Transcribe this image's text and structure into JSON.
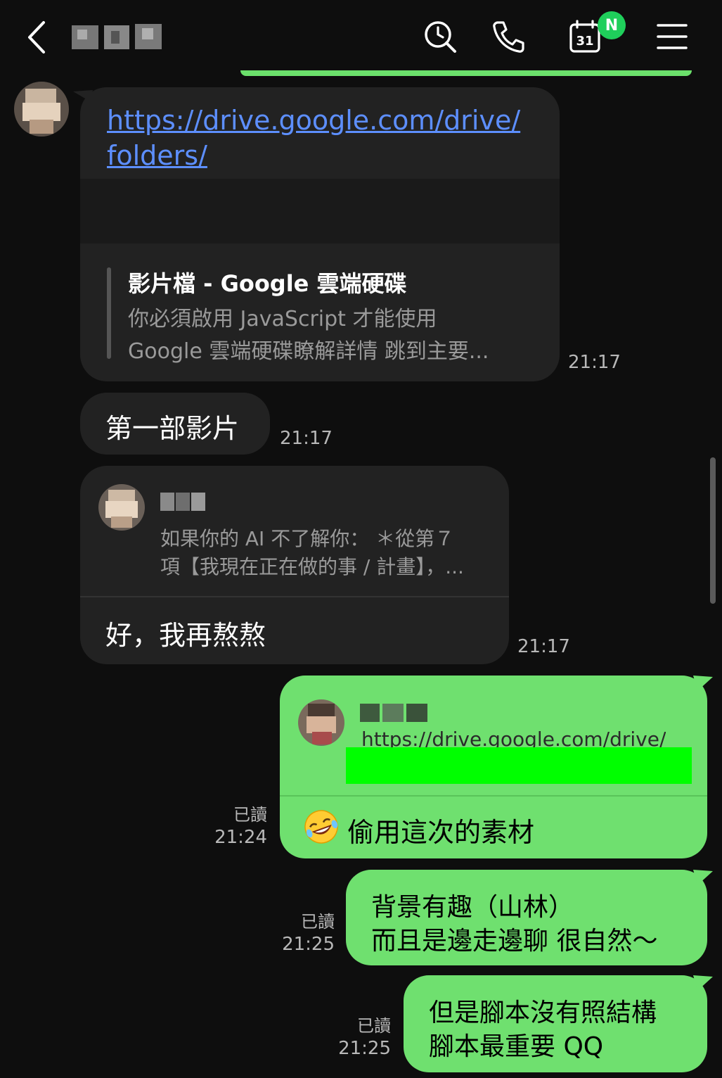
{
  "header": {
    "calendar_day": "31",
    "calendar_badge": "N"
  },
  "messages": {
    "link_card": {
      "url_line1": "https://drive.google.com/drive/",
      "url_line2": "folders/",
      "preview_title": "影片檔 - Google 雲端硬碟",
      "preview_desc1": "你必須啟用 JavaScript 才能使用",
      "preview_desc2": "Google 雲端硬碟瞭解詳情 跳到主要...",
      "time": "21:17"
    },
    "msg1": {
      "text": "第一部影片",
      "time": "21:17"
    },
    "reply1": {
      "quote_line1": "如果你的 AI 不了解你： ＊從第７",
      "quote_line2": "項【我現在正在做的事 / 計畫】，...",
      "text": "好，我再熬熬",
      "time": "21:17"
    },
    "reply2": {
      "quote_url": "https://drive.google.com/drive/",
      "text": "偷用這次的素材",
      "read": "已讀",
      "time": "21:24"
    },
    "msg2": {
      "line1": "背景有趣（山林）",
      "line2": "而且是邊走邊聊 很自然～",
      "read": "已讀",
      "time": "21:25"
    },
    "msg3": {
      "line1": "但是腳本沒有照結構",
      "line2": "腳本最重要 QQ",
      "read": "已讀",
      "time": "21:25"
    }
  },
  "colors": {
    "background": "#0e0e0e",
    "dark_bubble": "#222222",
    "green_bubble": "#6fe06f",
    "link": "#5d8fff",
    "redaction": "#00ff00"
  },
  "icons": [
    "back-icon",
    "search-history-icon",
    "phone-icon",
    "calendar-icon",
    "menu-icon",
    "laughing-emoji-icon"
  ]
}
